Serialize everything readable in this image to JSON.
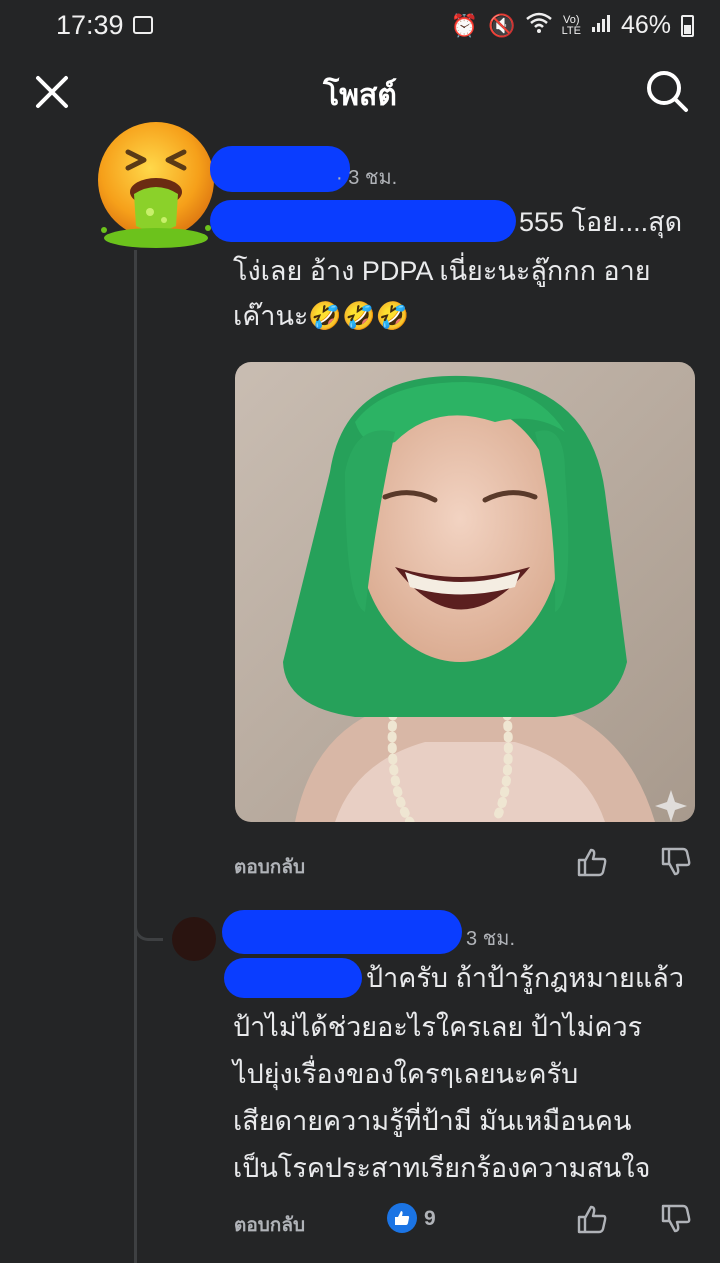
{
  "status_bar": {
    "time": "17:39",
    "battery": "46%",
    "icons": [
      "gallery-icon",
      "alarm-icon",
      "mute-icon",
      "wifi-icon",
      "volte-icon",
      "signal-icon",
      "battery-icon"
    ]
  },
  "header": {
    "title": "โพสต์"
  },
  "comments": [
    {
      "time": "· 3 ชม.",
      "lines": [
        "555 โอย....สุด",
        "โง่เลย อ้าง PDPA เนี่ยะนะลู๊กกก อาย",
        "เค๊านะ🤣🤣🤣"
      ],
      "reply_label": "ตอบกลับ"
    },
    {
      "time": "3 ชม.",
      "lines": [
        "ป้าครับ ถ้าป้ารู้กฎหมายแล้ว",
        "ป้าไม่ได้ช่วยอะไรใครเลย ป้าไม่ควร",
        "ไปยุ่งเรื่องของใครๆเลยนะครับ",
        "เสียดายความรู้ที่ป้ามี มันเหมือนคน",
        "เป็นโรคประสาทเรียกร้องความสนใจ"
      ],
      "reply_label": "ตอบกลับ",
      "reaction_count": "9"
    }
  ],
  "colors": {
    "background": "#242526",
    "redaction": "#0a3dff",
    "like_blue": "#1b74e4"
  }
}
